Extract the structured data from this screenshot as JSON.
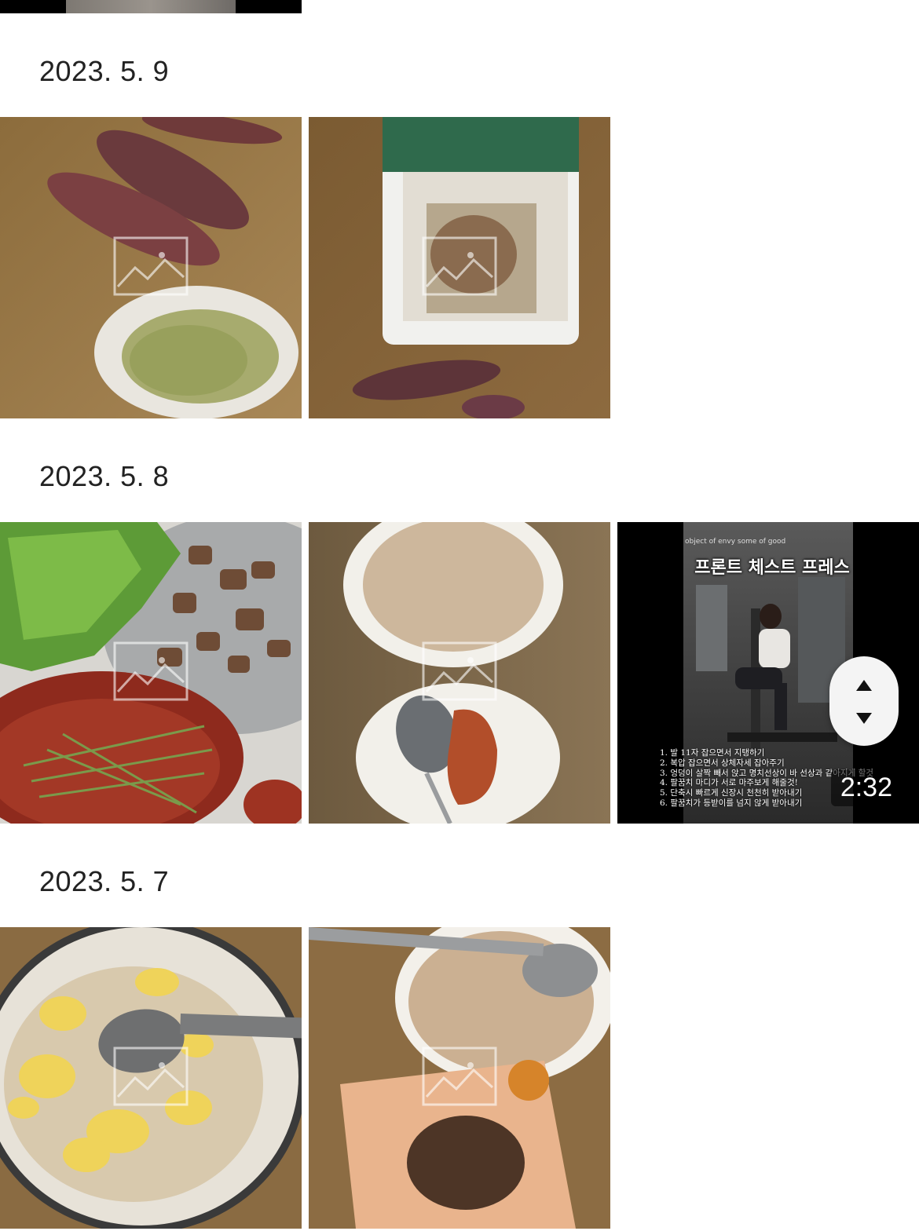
{
  "groups": [
    {
      "date": "2023. 5. 9",
      "items": [
        "sweet-potato-photo",
        "salad-package-photo"
      ]
    },
    {
      "date": "2023. 5. 8",
      "items": [
        "lettuce-pork-photo",
        "rice-chicken-photo",
        "chest-press-video"
      ]
    },
    {
      "date": "2023. 5. 7",
      "items": [
        "egg-rice-photo",
        "rice-package-photo"
      ]
    }
  ],
  "video": {
    "title": "프론트 체스트 프레스",
    "topline": "object of envy some of good",
    "duration": "2:32",
    "captions": [
      "1. 발 11자 잡으면서 지탱하기",
      "2. 복압 잡으면서 상체자세 잡아주기",
      "3. 엉덩이 살짝 빼서 앉고 명치선상이 바 선상과 같아지게 할것",
      "4. 팔꿈치 마디가 서로 마주보게 해줄것!",
      "5. 단축시 빠르게 신장시 천천히 받아내기",
      "6. 팔꿈치가 등받이를 넘지 않게 받아내기"
    ]
  },
  "icons": {
    "placeholder": "image-placeholder-icon",
    "scroll_up": "chevron-up-icon",
    "scroll_down": "chevron-down-icon"
  }
}
